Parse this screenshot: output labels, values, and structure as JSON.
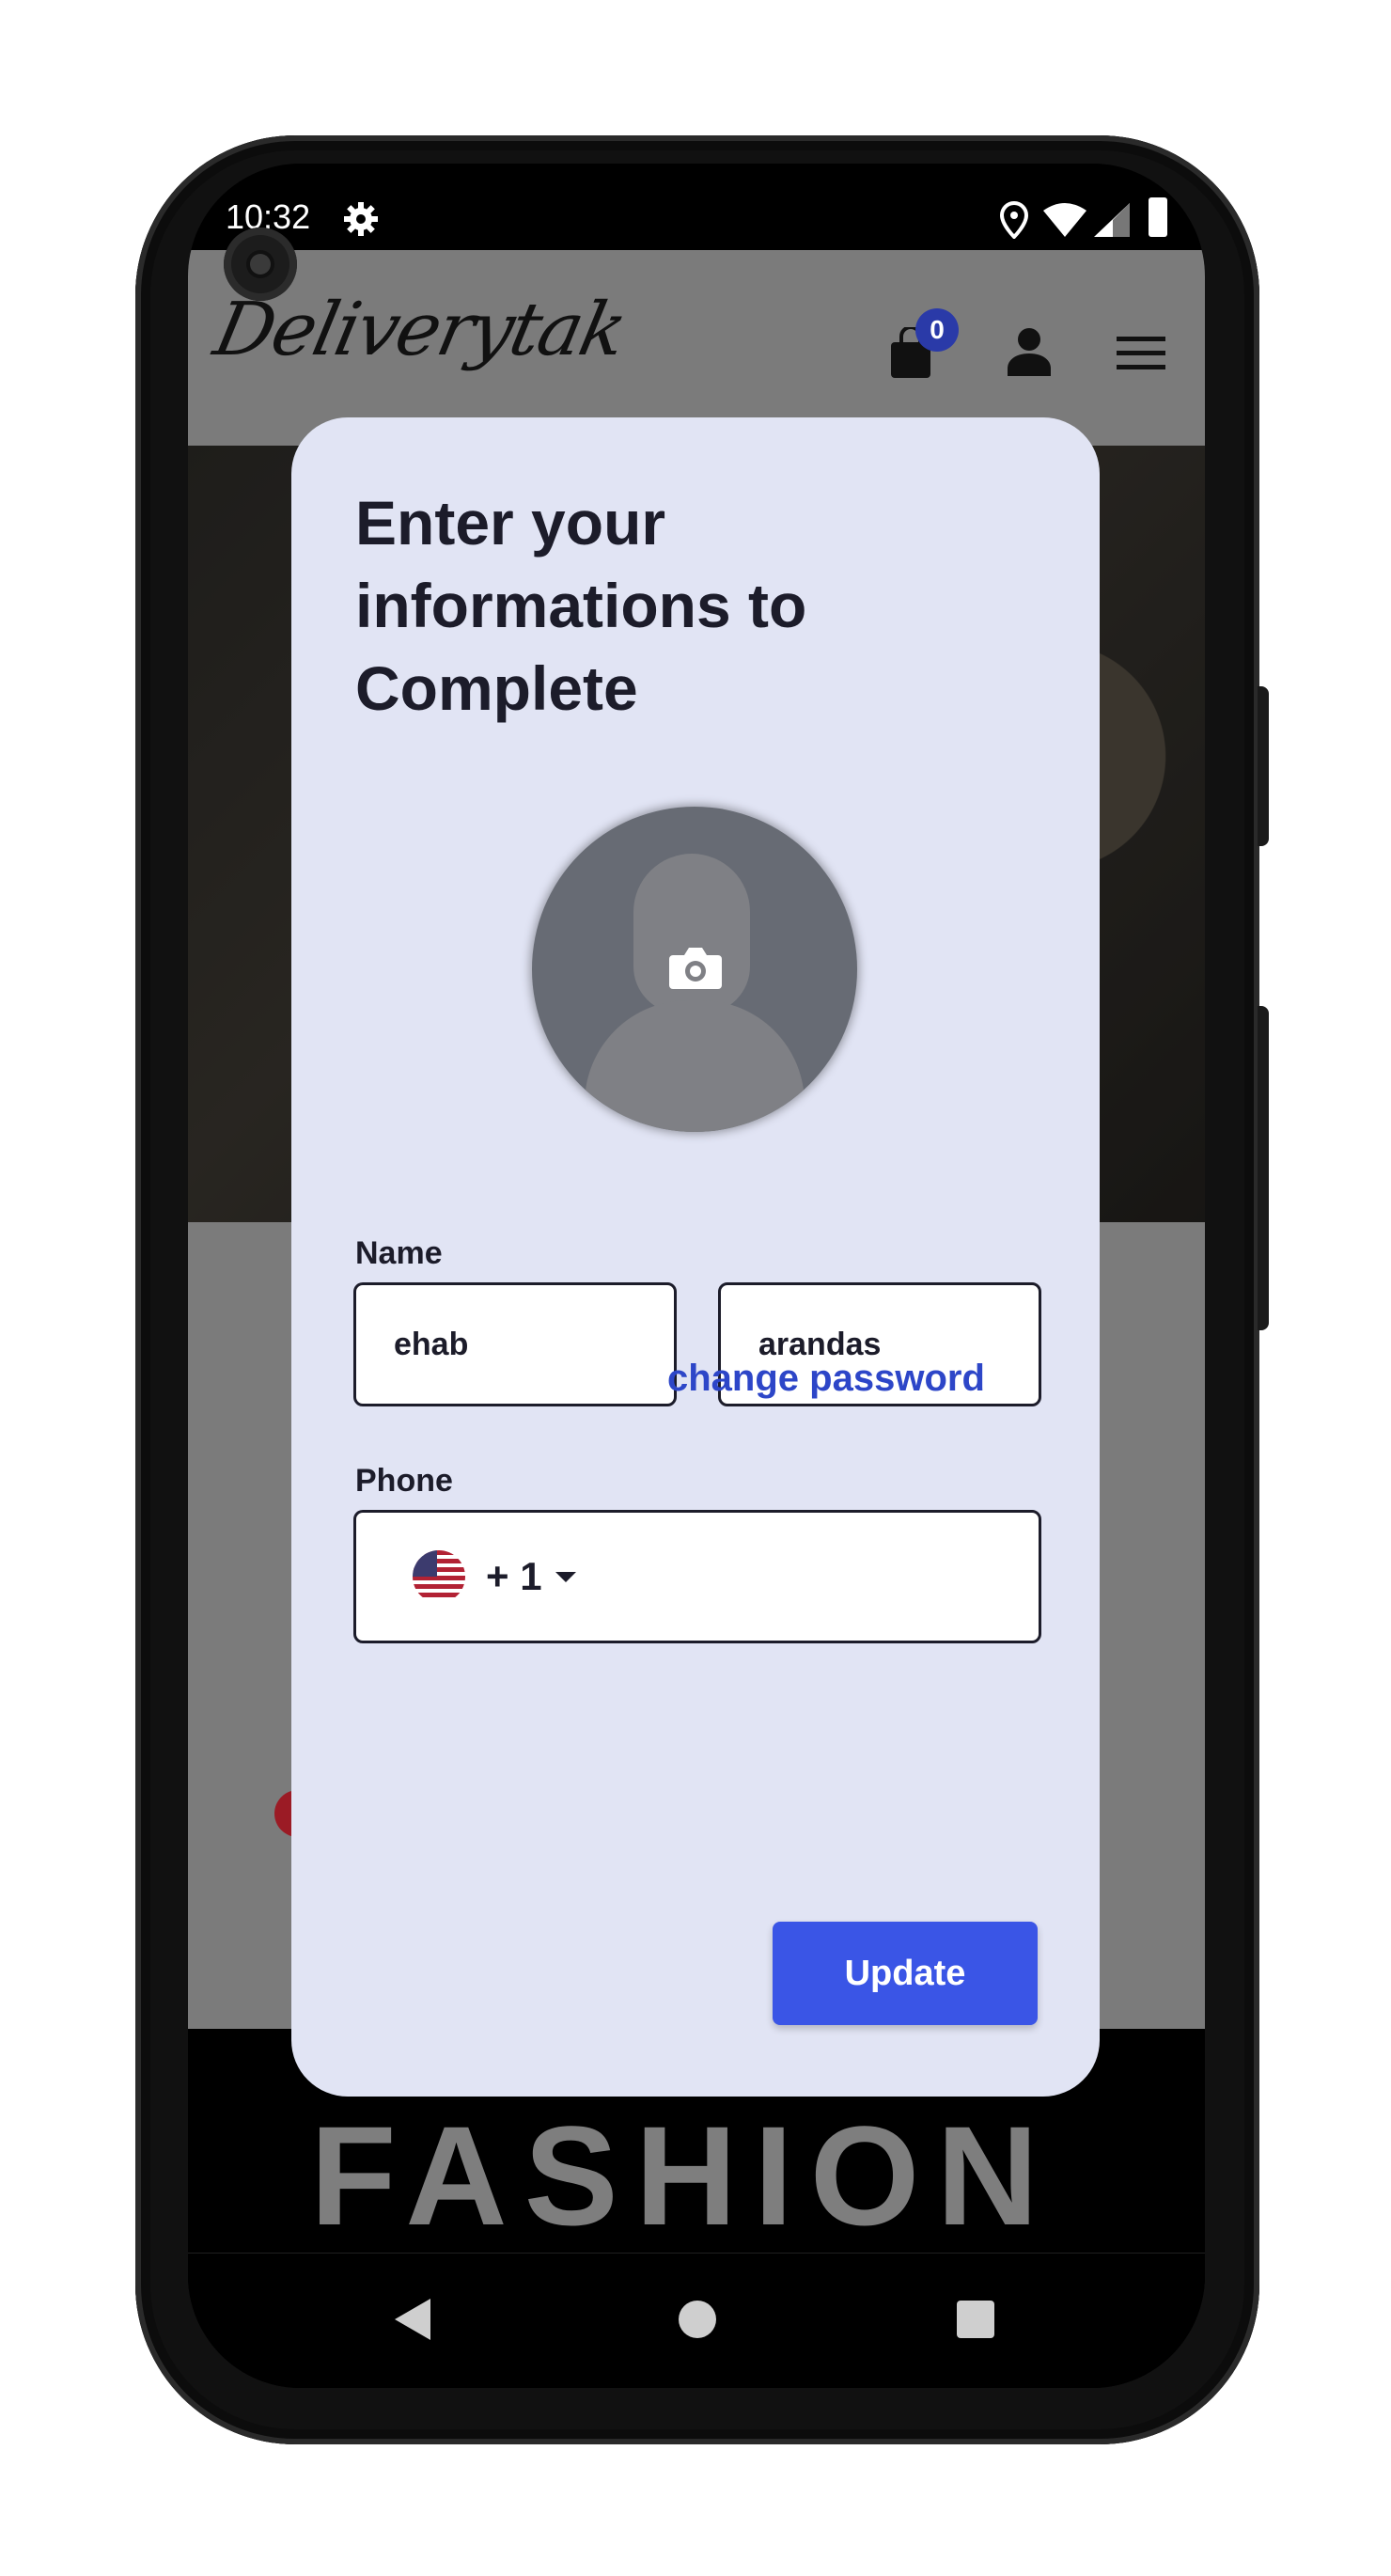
{
  "status_bar": {
    "time": "10:32",
    "icons": [
      "gear-icon",
      "location-icon",
      "wifi-icon",
      "signal-icon",
      "battery-icon"
    ]
  },
  "app_header": {
    "logo_text": "Deliverytak",
    "cart_count": "0",
    "icons": [
      "shopping-bag-icon",
      "user-icon",
      "menu-icon"
    ]
  },
  "modal": {
    "title": "Enter your informations to Complete",
    "avatar": {
      "icon": "camera-icon"
    },
    "name_label": "Name",
    "first_name": {
      "value": "ehab"
    },
    "last_name": {
      "value": "arandas"
    },
    "phone_label": "Phone",
    "phone": {
      "country_flag": "us-flag",
      "dial_code": "+ 1",
      "value": ""
    },
    "change_password_link": "change password",
    "update_button": "Update"
  },
  "background": {
    "footer_text": "FASHION"
  },
  "nav_bar": {
    "icons": [
      "back-icon",
      "home-icon",
      "recents-icon"
    ]
  },
  "colors": {
    "modal_bg": "#e1e4f4",
    "accent": "#3a55e6",
    "link": "#2d46c8",
    "badge": "#2a3aa8"
  }
}
